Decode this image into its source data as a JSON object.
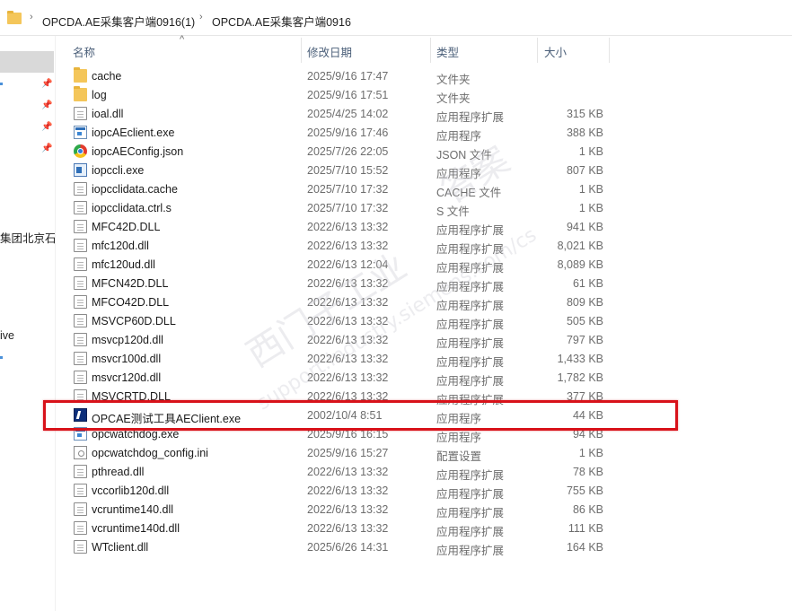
{
  "breadcrumb": {
    "items": [
      "OPCDA.AE采集客户端0916(1)",
      "OPCDA.AE采集客户端0916"
    ],
    "separator": "›"
  },
  "nav_pane": {
    "partial_labels": [
      "集团北京石",
      "ive"
    ]
  },
  "columns": {
    "name": "名称",
    "date": "修改日期",
    "type": "类型",
    "size": "大小"
  },
  "files": [
    {
      "icon": "folder-icon",
      "name": "cache",
      "date": "2025/9/16 17:47",
      "type": "文件夹",
      "size": ""
    },
    {
      "icon": "folder-icon",
      "name": "log",
      "date": "2025/9/16 17:51",
      "type": "文件夹",
      "size": ""
    },
    {
      "icon": "file-icon",
      "name": "ioal.dll",
      "date": "2025/4/25 14:02",
      "type": "应用程序扩展",
      "size": "315 KB"
    },
    {
      "icon": "exe-icon",
      "name": "iopcAEclient.exe",
      "date": "2025/9/16 17:46",
      "type": "应用程序",
      "size": "388 KB"
    },
    {
      "icon": "chrome-icon",
      "name": "iopcAEConfig.json",
      "date": "2025/7/26 22:05",
      "type": "JSON 文件",
      "size": "1 KB"
    },
    {
      "icon": "cli-icon",
      "name": "iopccli.exe",
      "date": "2025/7/10 15:52",
      "type": "应用程序",
      "size": "807 KB"
    },
    {
      "icon": "file-icon",
      "name": "iopcclidata.cache",
      "date": "2025/7/10 17:32",
      "type": "CACHE 文件",
      "size": "1 KB"
    },
    {
      "icon": "file-icon",
      "name": "iopcclidata.ctrl.s",
      "date": "2025/7/10 17:32",
      "type": "S 文件",
      "size": "1 KB"
    },
    {
      "icon": "file-icon",
      "name": "MFC42D.DLL",
      "date": "2022/6/13 13:32",
      "type": "应用程序扩展",
      "size": "941 KB"
    },
    {
      "icon": "file-icon",
      "name": "mfc120d.dll",
      "date": "2022/6/13 13:32",
      "type": "应用程序扩展",
      "size": "8,021 KB"
    },
    {
      "icon": "file-icon",
      "name": "mfc120ud.dll",
      "date": "2022/6/13 12:04",
      "type": "应用程序扩展",
      "size": "8,089 KB"
    },
    {
      "icon": "file-icon",
      "name": "MFCN42D.DLL",
      "date": "2022/6/13 13:32",
      "type": "应用程序扩展",
      "size": "61 KB"
    },
    {
      "icon": "file-icon",
      "name": "MFCO42D.DLL",
      "date": "2022/6/13 13:32",
      "type": "应用程序扩展",
      "size": "809 KB"
    },
    {
      "icon": "file-icon",
      "name": "MSVCP60D.DLL",
      "date": "2022/6/13 13:32",
      "type": "应用程序扩展",
      "size": "505 KB"
    },
    {
      "icon": "file-icon",
      "name": "msvcp120d.dll",
      "date": "2022/6/13 13:32",
      "type": "应用程序扩展",
      "size": "797 KB"
    },
    {
      "icon": "file-icon",
      "name": "msvcr100d.dll",
      "date": "2022/6/13 13:32",
      "type": "应用程序扩展",
      "size": "1,433 KB"
    },
    {
      "icon": "file-icon",
      "name": "msvcr120d.dll",
      "date": "2022/6/13 13:32",
      "type": "应用程序扩展",
      "size": "1,782 KB"
    },
    {
      "icon": "file-icon",
      "name": "MSVCRTD.DLL",
      "date": "2022/6/13 13:32",
      "type": "应用程序扩展",
      "size": "377 KB"
    },
    {
      "icon": "opc-icon",
      "name": "OPCAE测试工具AEClient.exe",
      "date": "2002/10/4 8:51",
      "type": "应用程序",
      "size": "44 KB"
    },
    {
      "icon": "exe-icon",
      "name": "opcwatchdog.exe",
      "date": "2025/9/16 16:15",
      "type": "应用程序",
      "size": "94 KB"
    },
    {
      "icon": "ini-icon",
      "name": "opcwatchdog_config.ini",
      "date": "2025/9/16 15:27",
      "type": "配置设置",
      "size": "1 KB"
    },
    {
      "icon": "file-icon",
      "name": "pthread.dll",
      "date": "2022/6/13 13:32",
      "type": "应用程序扩展",
      "size": "78 KB"
    },
    {
      "icon": "file-icon",
      "name": "vccorlib120d.dll",
      "date": "2022/6/13 13:32",
      "type": "应用程序扩展",
      "size": "755 KB"
    },
    {
      "icon": "file-icon",
      "name": "vcruntime140.dll",
      "date": "2022/6/13 13:32",
      "type": "应用程序扩展",
      "size": "86 KB"
    },
    {
      "icon": "file-icon",
      "name": "vcruntime140d.dll",
      "date": "2022/6/13 13:32",
      "type": "应用程序扩展",
      "size": "111 KB"
    },
    {
      "icon": "file-icon",
      "name": "WTclient.dll",
      "date": "2025/6/26 14:31",
      "type": "应用程序扩展",
      "size": "164 KB"
    }
  ],
  "highlighted_file": "OPCAE测试工具AEClient.exe",
  "watermark": {
    "line1": "西门子工业",
    "line2": "support.industry.siemens.com/cs",
    "line3": "答案"
  },
  "colors": {
    "highlight_border": "#d8121a",
    "header_text": "#4c607a",
    "folder": "#f4c65a"
  }
}
